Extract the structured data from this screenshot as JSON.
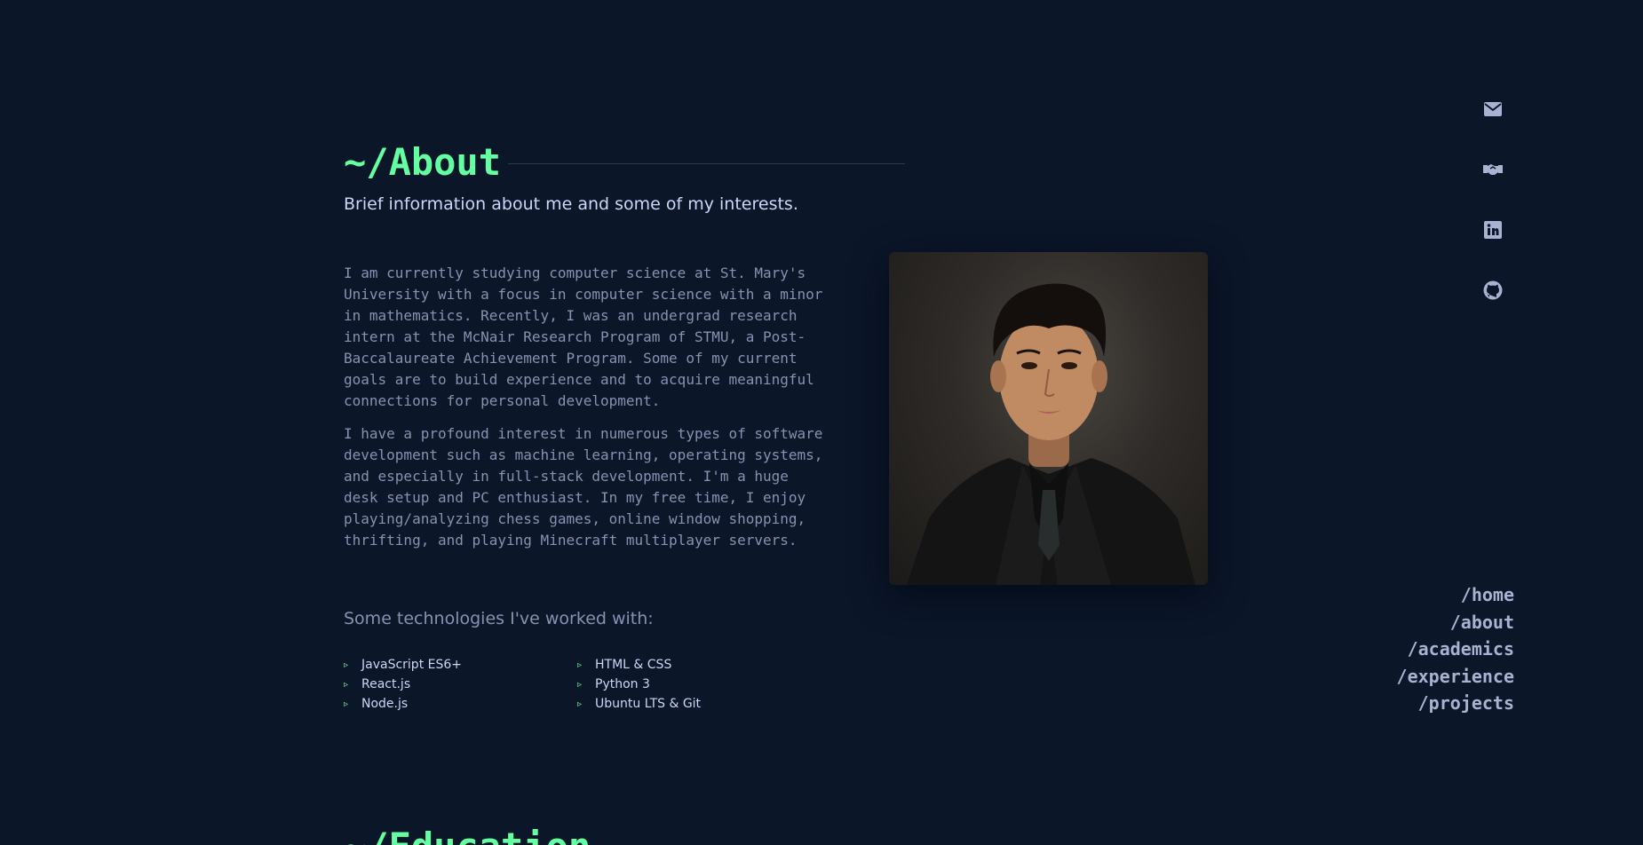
{
  "about": {
    "title": "~/About",
    "subtitle": "Brief information about me and some of my interests.",
    "paragraphs": [
      "I am currently studying computer science at St. Mary's University with a focus in computer science with a minor in mathematics. Recently, I was an undergrad research intern at the McNair Research Program of STMU, a Post-Baccalaureate Achievement Program. Some of my current goals are to build experience and to acquire meaningful connections for personal development.",
      "I have a profound interest in numerous types of software development such as machine learning, operating systems, and especially in full-stack development. I'm a huge desk setup and PC enthusiast. In my free time, I enjoy playing/analyzing chess games, online window shopping, thrifting, and playing Minecraft multiplayer servers."
    ],
    "tech_intro": "Some technologies I've worked with:",
    "bullet": "▹",
    "technologies": [
      "JavaScript ES6+",
      "HTML & CSS",
      "React.js",
      "Python 3",
      "Node.js",
      "Ubuntu LTS & Git"
    ]
  },
  "social": [
    {
      "icon": "mail-icon"
    },
    {
      "icon": "handshake-icon"
    },
    {
      "icon": "linkedin-icon"
    },
    {
      "icon": "github-icon"
    }
  ],
  "nav": {
    "items": [
      "/home",
      "/about",
      "/academics",
      "/experience",
      "/projects"
    ]
  },
  "next_section": {
    "title": "~/Education"
  },
  "colors": {
    "background": "#0b1629",
    "accent": "#64ffa0",
    "heading_text": "#ccd6f6",
    "body_text": "#8892b0",
    "nav_text": "#a8b2d1",
    "rule": "#2e3a55"
  }
}
